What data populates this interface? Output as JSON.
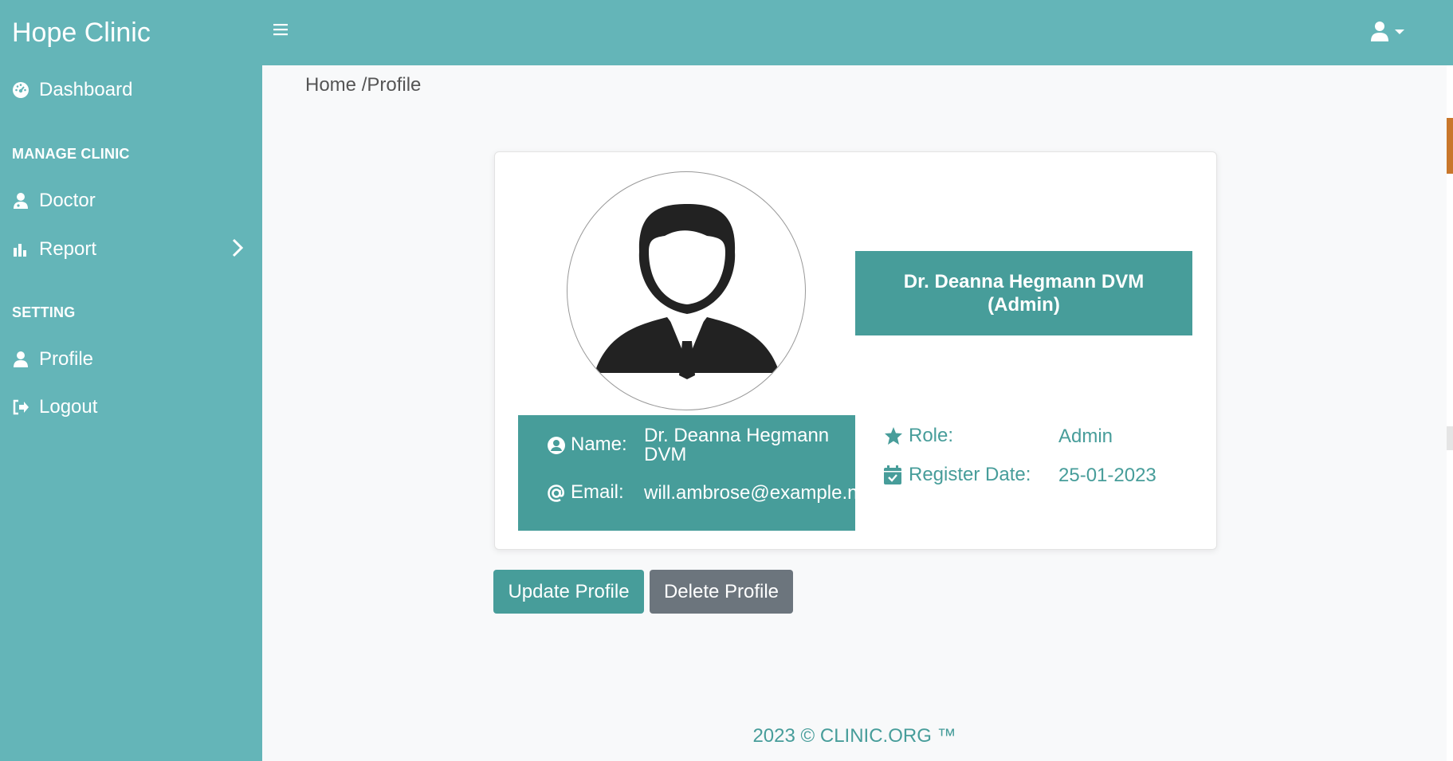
{
  "app": {
    "brand": "Hope Clinic"
  },
  "sidebar": {
    "dashboard": "Dashboard",
    "section_manage": "MANAGE CLINIC",
    "doctor": "Doctor",
    "report": "Report",
    "section_setting": "SETTING",
    "profile": "Profile",
    "logout": "Logout"
  },
  "breadcrumb": {
    "home": "Home",
    "current": "/Profile"
  },
  "profile": {
    "banner_name": "Dr. Deanna Hegmann DVM",
    "banner_role": "(Admin)",
    "name_label": "Name:",
    "name_value_line1": "Dr. Deanna Hegmann",
    "name_value_line2": "DVM",
    "email_label": "Email:",
    "email_value": "will.ambrose@example.net",
    "role_label": "Role:",
    "role_value": "Admin",
    "register_label": "Register Date:",
    "register_value": "25-01-2023"
  },
  "actions": {
    "update": "Update Profile",
    "delete": "Delete Profile"
  },
  "footer": {
    "text": "2023 © CLINIC.ORG ™"
  },
  "colors": {
    "sidebar": "#64b5b8",
    "accent": "#479d9a",
    "secondary": "#6c757d",
    "background": "#f8f9fa"
  },
  "icons": [
    "tachometer-icon",
    "user-md-icon",
    "bar-chart-icon",
    "chevron-right-icon",
    "user-icon",
    "sign-out-icon",
    "bars-icon",
    "user-circle-icon",
    "at-icon",
    "star-icon",
    "calendar-check-icon",
    "avatar-silhouette"
  ]
}
